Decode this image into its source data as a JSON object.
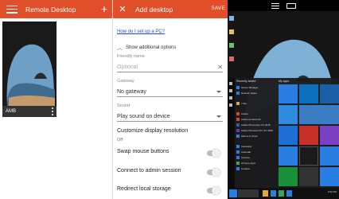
{
  "left_pane": {
    "title": "Remote Desktop",
    "add_label": "+",
    "connection": {
      "name": "AMB"
    }
  },
  "add_desktop": {
    "title": "Add desktop",
    "close_label": "✕",
    "save_label": "SAVE",
    "help_link": "How do I set up a PC?",
    "additional_options_label": "Show additional options",
    "friendly_name": {
      "label": "Friendly name",
      "value": "",
      "placeholder": "Optional"
    },
    "gateway": {
      "label": "Gateway",
      "value": "No gateway"
    },
    "sound": {
      "label": "Sound",
      "value": "Play sound on device"
    },
    "display": {
      "label": "Customize display resolution",
      "sub": "Off"
    },
    "swap_mouse": {
      "label": "Swap mouse buttons",
      "on": false
    },
    "admin_session": {
      "label": "Connect to admin session",
      "on": false
    },
    "redirect_storage": {
      "label": "Redirect local storage",
      "on": false
    }
  },
  "remote_session": {
    "start_menu": {
      "recent_header": "Recently added",
      "pinned_header": "My apps",
      "apps": [
        "Server Manager",
        "Network status",
        "7-Zip",
        "Adobe",
        "Adobe Acrobat DC",
        "Adobe Photoshop CC 2018",
        "Adobe Premiere Pro CC 2018",
        "Alarms & Clock",
        "Calculator",
        "Calendar",
        "Camera",
        "Chrome Apps",
        "Cortana"
      ]
    },
    "taskbar": {
      "clock": "2:52 PM"
    }
  },
  "colors": {
    "accent": "#e04f2a",
    "link": "#1a4fc4",
    "start_blue": "#2a7de1"
  }
}
